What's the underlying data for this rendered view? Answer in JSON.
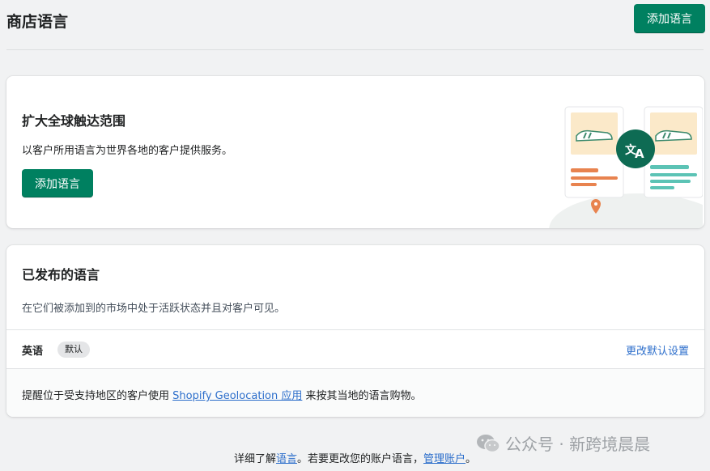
{
  "header": {
    "title": "商店语言",
    "add_button": "添加语言"
  },
  "reach_card": {
    "title": "扩大全球触达范围",
    "description": "以客户所用语言为世界各地的客户提供服务。",
    "add_button": "添加语言"
  },
  "published_card": {
    "title": "已发布的语言",
    "description": "在它们被添加到的市场中处于活跃状态并且对客户可见。",
    "languages": [
      {
        "name": "英语",
        "badge": "默认",
        "action": "更改默认设置"
      }
    ],
    "geo_prefix": "提醒位于受支持地区的客户使用",
    "geo_link": "Shopify Geolocation 应用",
    "geo_suffix": "来按其当地的语言购物。"
  },
  "footer": {
    "prefix": "详细了解",
    "link1": "语言",
    "middle": "。若要更改您的账户语言，",
    "link2": "管理账户",
    "suffix": "。"
  },
  "watermark": "公众号 · 新跨境晨晨",
  "colors": {
    "primary": "#008060",
    "link": "#2c6ecb",
    "accent_orange": "#e8834f",
    "accent_teal": "#5cc3b5"
  }
}
